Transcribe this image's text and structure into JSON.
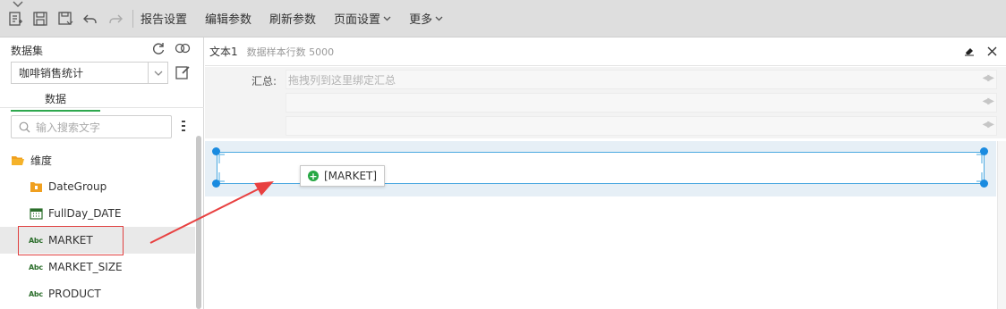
{
  "toolbar": {
    "menus": [
      {
        "label": "报告设置",
        "dropdown": false
      },
      {
        "label": "编辑参数",
        "dropdown": false
      },
      {
        "label": "刷新参数",
        "dropdown": false
      },
      {
        "label": "页面设置",
        "dropdown": true
      },
      {
        "label": "更多",
        "dropdown": true
      }
    ],
    "icons": [
      "new-report-icon",
      "save-icon",
      "save-as-icon",
      "undo-icon",
      "redo-icon"
    ],
    "caret": "⌄"
  },
  "left_panel": {
    "title": "数据集",
    "dataset_value": "咖啡销售统计",
    "tab_label": "数据",
    "search_placeholder": "输入搜索文字",
    "tree": {
      "root_label": "维度",
      "items": [
        {
          "label": "DateGroup",
          "type": "folder-orange"
        },
        {
          "label": "FullDay_DATE",
          "type": "calendar"
        },
        {
          "label": "MARKET",
          "type": "abc",
          "selected": true
        },
        {
          "label": "MARKET_SIZE",
          "type": "abc"
        },
        {
          "label": "PRODUCT",
          "type": "abc"
        }
      ],
      "abc_text": "Abc"
    }
  },
  "right_panel": {
    "title": "文本1",
    "subtitle": "数据样本行数 5000",
    "summary_label": "汇总:",
    "summary_placeholder": "拖拽列到这里绑定汇总",
    "drag_tip": "[MARKET]",
    "plus": "+",
    "lr": "◀▶"
  },
  "colors": {
    "accent_green": "#2fa84f",
    "selection_blue": "#1a8be0",
    "annotation_red": "#e84040"
  }
}
